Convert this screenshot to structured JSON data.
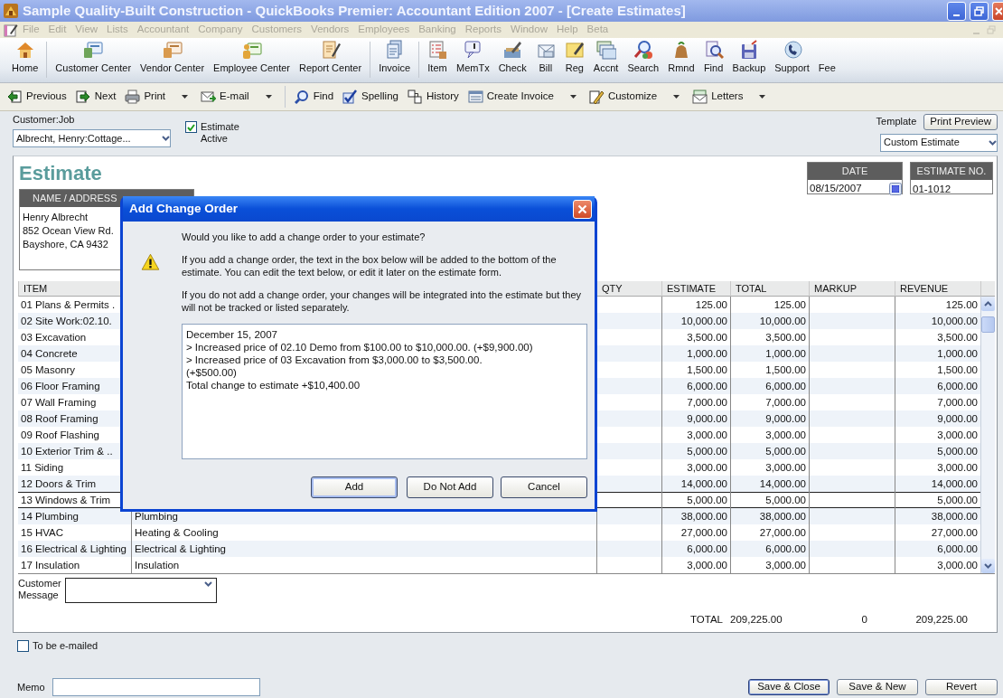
{
  "window": {
    "title": "Sample Quality-Built Construction - QuickBooks Premier: Accountant Edition 2007 - [Create Estimates]"
  },
  "menu": {
    "disabled": true,
    "items": [
      "File",
      "Edit",
      "View",
      "Lists",
      "Accountant",
      "Company",
      "Customers",
      "Vendors",
      "Employees",
      "Banking",
      "Reports",
      "Window",
      "Help",
      "Beta"
    ]
  },
  "icon_toolbar": [
    {
      "label": "Home"
    },
    {
      "label": "Customer Center"
    },
    {
      "label": "Vendor Center"
    },
    {
      "label": "Employee Center"
    },
    {
      "label": "Report Center"
    },
    {
      "label": "Invoice"
    },
    {
      "label": "Item"
    },
    {
      "label": "MemTx"
    },
    {
      "label": "Check"
    },
    {
      "label": "Bill"
    },
    {
      "label": "Reg"
    },
    {
      "label": "Accnt"
    },
    {
      "label": "Search"
    },
    {
      "label": "Rmnd"
    },
    {
      "label": "Find"
    },
    {
      "label": "Backup"
    },
    {
      "label": "Support"
    },
    {
      "label": "Fee"
    }
  ],
  "action_toolbar": [
    {
      "label": "Previous",
      "dropdown": false
    },
    {
      "label": "Next",
      "dropdown": false
    },
    {
      "label": "Print",
      "dropdown": true
    },
    {
      "label": "E-mail",
      "dropdown": true
    },
    {
      "label": "Find",
      "dropdown": false
    },
    {
      "label": "Spelling",
      "dropdown": false
    },
    {
      "label": "History",
      "dropdown": false
    },
    {
      "label": "Create Invoice",
      "dropdown": true
    },
    {
      "label": "Customize",
      "dropdown": true
    },
    {
      "label": "Letters",
      "dropdown": true
    }
  ],
  "customer_job": {
    "label": "Customer:Job",
    "value": "Albrecht, Henry:Cottage..."
  },
  "estimate_active": {
    "label_lines": [
      "Estimate",
      "Active"
    ],
    "checked": true
  },
  "template": {
    "label": "Template",
    "button": "Print Preview",
    "value": "Custom Estimate"
  },
  "form_title": "Estimate",
  "name_address": {
    "header": "NAME / ADDRESS",
    "lines": [
      "Henry Albrecht",
      "852 Ocean View Rd.",
      "Bayshore, CA 9432"
    ]
  },
  "date": {
    "header": "DATE",
    "value": "08/15/2007"
  },
  "estimate_no": {
    "header": "ESTIMATE NO.",
    "value": "01-1012"
  },
  "table": {
    "columns": [
      "ITEM",
      "QTY",
      "ESTIMATE",
      "TOTAL",
      "MARKUP",
      "REVENUE"
    ],
    "rows": [
      {
        "item": "01 Plans & Permits .",
        "estimate": "125.00",
        "total": "125.00",
        "revenue": "125.00",
        "selected": false
      },
      {
        "item": "02 Site Work:02.10.",
        "estimate": "10,000.00",
        "total": "10,000.00",
        "revenue": "10,000.00",
        "selected": false
      },
      {
        "item": "03 Excavation",
        "estimate": "3,500.00",
        "total": "3,500.00",
        "revenue": "3,500.00",
        "selected": false
      },
      {
        "item": "04 Concrete",
        "estimate": "1,000.00",
        "total": "1,000.00",
        "revenue": "1,000.00",
        "selected": false
      },
      {
        "item": "05 Masonry",
        "estimate": "1,500.00",
        "total": "1,500.00",
        "revenue": "1,500.00",
        "selected": false
      },
      {
        "item": "06 Floor Framing",
        "estimate": "6,000.00",
        "total": "6,000.00",
        "revenue": "6,000.00",
        "selected": false
      },
      {
        "item": "07 Wall Framing",
        "estimate": "7,000.00",
        "total": "7,000.00",
        "revenue": "7,000.00",
        "selected": false
      },
      {
        "item": "08 Roof Framing",
        "estimate": "9,000.00",
        "total": "9,000.00",
        "revenue": "9,000.00",
        "selected": false
      },
      {
        "item": "09 Roof Flashing",
        "estimate": "3,000.00",
        "total": "3,000.00",
        "revenue": "3,000.00",
        "selected": false
      },
      {
        "item": "10 Exterior Trim & ..",
        "estimate": "5,000.00",
        "total": "5,000.00",
        "revenue": "5,000.00",
        "selected": false
      },
      {
        "item": "11 Siding",
        "estimate": "3,000.00",
        "total": "3,000.00",
        "revenue": "3,000.00",
        "selected": false
      },
      {
        "item": "12 Doors & Trim",
        "estimate": "14,000.00",
        "total": "14,000.00",
        "revenue": "14,000.00",
        "selected": false
      },
      {
        "item": "13 Windows & Trim",
        "estimate": "5,000.00",
        "total": "5,000.00",
        "revenue": "5,000.00",
        "selected": true
      },
      {
        "item": "14 Plumbing",
        "description": "Plumbing",
        "estimate": "38,000.00",
        "total": "38,000.00",
        "revenue": "38,000.00",
        "selected": false
      },
      {
        "item": "15 HVAC",
        "description": "Heating & Cooling",
        "estimate": "27,000.00",
        "total": "27,000.00",
        "revenue": "27,000.00",
        "selected": false
      },
      {
        "item": "16 Electrical & Lighting",
        "description": "Electrical & Lighting",
        "estimate": "6,000.00",
        "total": "6,000.00",
        "revenue": "6,000.00",
        "selected": false
      },
      {
        "item": "17 Insulation",
        "description": "Insulation",
        "estimate": "3,000.00",
        "total": "3,000.00",
        "revenue": "3,000.00",
        "selected": false
      }
    ]
  },
  "customer_message": {
    "label_lines": [
      "Customer",
      "Message"
    ]
  },
  "totals": {
    "label": "TOTAL",
    "total": "209,225.00",
    "markup": "0",
    "revenue": "209,225.00"
  },
  "to_be_emailed": {
    "label": "To be e-mailed",
    "checked": false
  },
  "memo": {
    "label": "Memo"
  },
  "buttons": [
    {
      "label": "Save & Close",
      "default": true
    },
    {
      "label": "Save & New",
      "default": false
    },
    {
      "label": "Revert",
      "default": false
    }
  ],
  "dialog": {
    "title": "Add Change Order",
    "paragraphs": [
      "Would you like to add a change order to your estimate?",
      "If you add a change order, the text in the box below will be added to the bottom of the estimate.  You can edit the text below, or edit it later on the estimate form.",
      "If you do not add a change order, your changes will be integrated into the estimate but they will not be tracked or listed separately."
    ],
    "text_lines": [
      "December 15, 2007",
      "> Increased price of 02.10 Demo from $100.00 to $10,000.00. (+$9,900.00)",
      "> Increased price of 03 Excavation from $3,000.00 to $3,500.00.",
      "(+$500.00)",
      "Total change to estimate +$10,400.00"
    ],
    "buttons": [
      {
        "label": "Add",
        "default": true
      },
      {
        "label": "Do Not Add",
        "default": false
      },
      {
        "label": "Cancel",
        "default": false
      }
    ]
  }
}
